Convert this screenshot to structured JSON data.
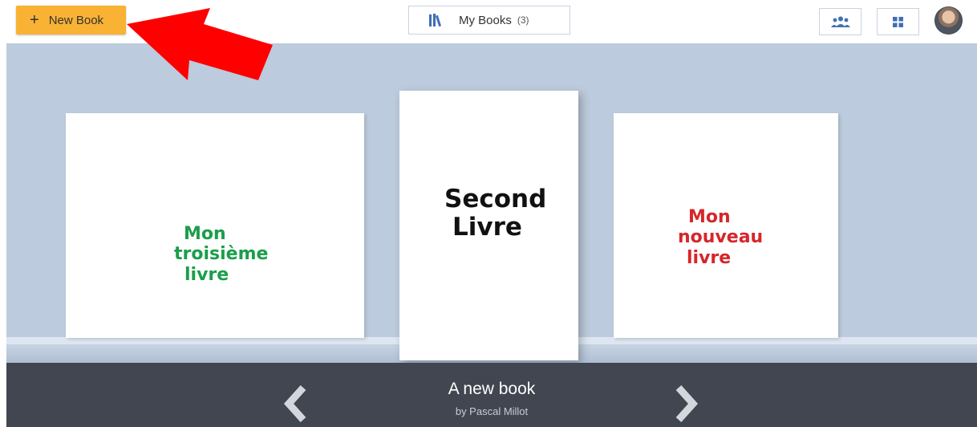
{
  "header": {
    "new_book_label": "New Book",
    "new_book_icon": "plus-icon",
    "my_books_label": "My Books",
    "my_books_count": "(3)",
    "accent_color": "#f9b233"
  },
  "toolbar": {
    "icons": [
      "books-icon",
      "users-icon",
      "grid-icon",
      "avatar"
    ]
  },
  "books": [
    {
      "title_lines": [
        "Mon",
        "troisième",
        "livre"
      ],
      "color": "#1b9e4a"
    },
    {
      "title_lines": [
        "Second",
        "Livre"
      ],
      "color": "#111111"
    },
    {
      "title_lines": [
        "Mon",
        "nouveau",
        "livre"
      ],
      "color": "#d6262a"
    }
  ],
  "selected_book": {
    "title": "A new book",
    "author": "by Pascal Millot"
  },
  "annotation": {
    "color": "#ff0000"
  }
}
